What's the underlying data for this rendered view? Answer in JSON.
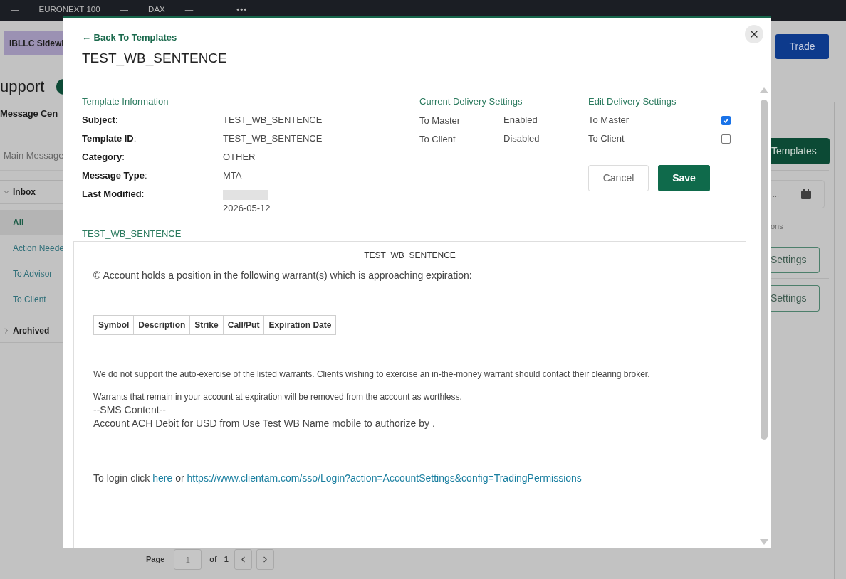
{
  "ticker_bar": {
    "tickers": [
      {
        "value": "—"
      },
      {
        "name": "EURONEXT 100",
        "value": "—"
      },
      {
        "name": "DAX",
        "value": "—"
      }
    ],
    "more": "•••"
  },
  "header": {
    "account_tag": "IBLLC Sidewi",
    "trade_button": "Trade"
  },
  "page": {
    "title": "upport",
    "section_title": "Message Cen",
    "main_tab": "Main Message"
  },
  "sidebar": {
    "groups": [
      {
        "label": "Inbox",
        "expanded": true,
        "children": [
          {
            "label": "All",
            "selected": true
          },
          {
            "label": "Action Neede",
            "selected": false
          },
          {
            "label": "To Advisor",
            "selected": false
          },
          {
            "label": "To Client",
            "selected": false
          }
        ]
      },
      {
        "label": "Archived",
        "expanded": false
      }
    ]
  },
  "right_panel": {
    "templates_button": "Templates",
    "date_field": {
      "placeholder": "..."
    },
    "column_label": "ons",
    "settings_buttons": [
      "Settings",
      "Settings"
    ]
  },
  "pagination": {
    "label": "Page",
    "page_value": "1",
    "of_label": "of",
    "total": "1"
  },
  "modal": {
    "back_link": "← Back To Templates",
    "title": "TEST_WB_SENTENCE",
    "template_info": {
      "heading": "Template Information",
      "rows": [
        {
          "label": "**Subject**:",
          "value": "TEST_WB_SENTENCE",
          "redacted": false
        },
        {
          "label": "**Template ID**:",
          "value": "TEST_WB_SENTENCE",
          "redacted": false
        },
        {
          "label": "**Category**:",
          "value": "OTHER",
          "redacted": false
        },
        {
          "label": "**Message Type**:",
          "value": "MTA",
          "redacted": false
        },
        {
          "label": "**Last Modified**:",
          "value": "2026-05-12",
          "redacted": true
        }
      ]
    },
    "current_delivery": {
      "heading": "Current Delivery Settings",
      "rows": [
        {
          "label": "To Master",
          "status": "Enabled"
        },
        {
          "label": "To Client",
          "status": "Disabled"
        }
      ]
    },
    "edit_delivery": {
      "heading": "Edit Delivery Settings",
      "options": [
        {
          "label": "To Master",
          "checked": true
        },
        {
          "label": "To Client",
          "checked": false
        }
      ],
      "buttons": [
        {
          "label": "Cancel",
          "kind": "secondary"
        },
        {
          "label": "Save",
          "kind": "primary"
        }
      ]
    },
    "preview": {
      "section_heading": "TEST_WB_SENTENCE",
      "title": "TEST_WB_SENTENCE",
      "intro": "© Account holds a position in the following warrant(s) which is approaching expiration:",
      "table_columns": [
        "Symbol",
        "Description",
        "Strike",
        "Call/Put",
        "Expiration Date"
      ],
      "notes": [
        "We do not support the auto-exercise of the listed warrants. Clients wishing to exercise an in-the-money warrant should contact their clearing broker.",
        "Warrants that remain in your account at expiration will be removed from the account as worthless."
      ],
      "sms_lines": [
        "--SMS Content--",
        "Account ACH Debit for USD from Use Test WB Name mobile to authorize by ."
      ],
      "login": {
        "prefix": "To login click",
        "link": "here",
        "joiner": "or",
        "url": "https://www.clientam.com/sso/Login?action=AccountSettings&config=TradingPermissions"
      }
    }
  }
}
